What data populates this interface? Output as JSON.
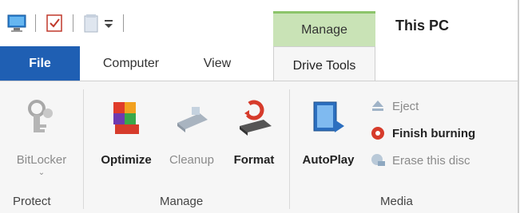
{
  "quick_access": {
    "icons": [
      "computer-icon",
      "properties-check-icon",
      "new-folder-icon",
      "customize-dropdown-icon"
    ]
  },
  "context_tab_group": {
    "label": "Manage"
  },
  "window": {
    "title": "This PC"
  },
  "tabs": {
    "file": "File",
    "computer": "Computer",
    "view": "View",
    "drive_tools": "Drive Tools"
  },
  "ribbon": {
    "protect": {
      "group_label": "Protect",
      "bitlocker": {
        "label": "BitLocker",
        "icon": "bitlocker-key-icon",
        "enabled": false
      }
    },
    "manage": {
      "group_label": "Manage",
      "optimize": {
        "label": "Optimize",
        "icon": "optimize-icon",
        "enabled": true
      },
      "cleanup": {
        "label": "Cleanup",
        "icon": "cleanup-icon",
        "enabled": false
      },
      "format": {
        "label": "Format",
        "icon": "format-icon",
        "enabled": true
      }
    },
    "media": {
      "group_label": "Media",
      "autoplay": {
        "label": "AutoPlay",
        "icon": "autoplay-icon",
        "enabled": true
      },
      "eject": {
        "label": "Eject",
        "icon": "eject-icon",
        "enabled": false
      },
      "finish_burning": {
        "label": "Finish burning",
        "icon": "finish-burning-icon",
        "enabled": true
      },
      "erase_disc": {
        "label": "Erase this disc",
        "icon": "erase-disc-icon",
        "enabled": false
      }
    }
  },
  "colors": {
    "file_tab": "#1f5fb3",
    "context_tab": "#c9e3b6",
    "ribbon_bg": "#f6f6f6"
  }
}
